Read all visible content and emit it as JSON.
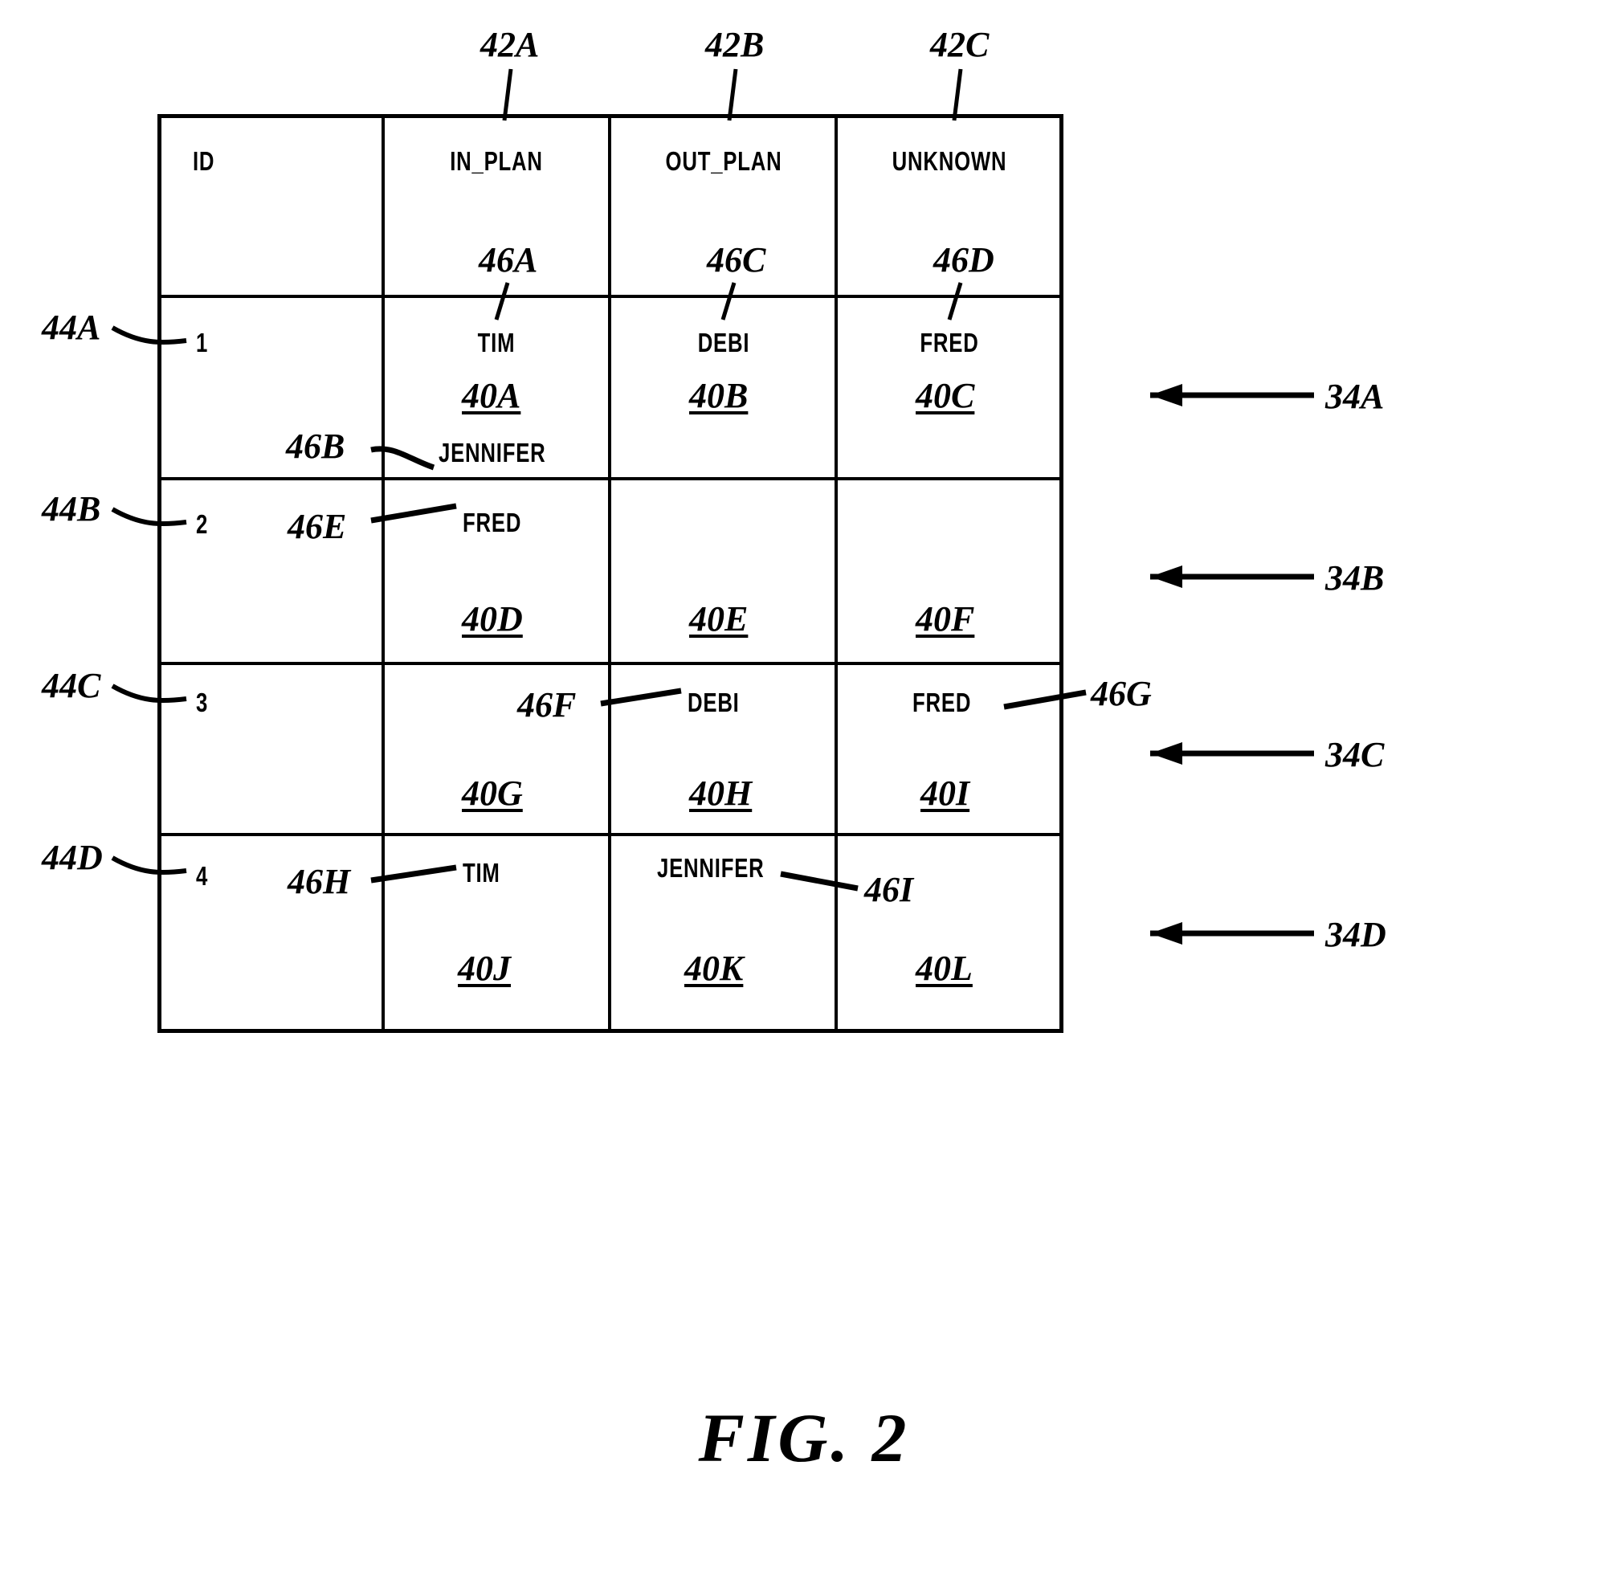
{
  "figure": {
    "caption": "FIG.  2",
    "table_ref_rows": [
      "34A",
      "34B",
      "34C",
      "34D"
    ],
    "row_id_refs": [
      "44A",
      "44B",
      "44C",
      "44D"
    ],
    "column_refs": [
      "42A",
      "42B",
      "42C"
    ]
  },
  "table": {
    "headers": [
      "ID",
      "IN_PLAN",
      "OUT_PLAN",
      "UNKNOWN"
    ],
    "header_refs": [
      "",
      "42A",
      "42B",
      "42C"
    ],
    "rows": [
      {
        "id": "1",
        "id_ref": "44A",
        "row_ref": "34A",
        "cells": [
          {
            "column": "IN_PLAN",
            "names": [
              "TIM",
              "JENNIFER"
            ],
            "name_refs": [
              "46A",
              "46B"
            ],
            "cell_ref": "40A"
          },
          {
            "column": "OUT_PLAN",
            "names": [
              "DEBI"
            ],
            "name_refs": [
              "46C"
            ],
            "cell_ref": "40B"
          },
          {
            "column": "UNKNOWN",
            "names": [
              "FRED"
            ],
            "name_refs": [
              "46D"
            ],
            "cell_ref": "40C"
          }
        ]
      },
      {
        "id": "2",
        "id_ref": "44B",
        "row_ref": "34B",
        "cells": [
          {
            "column": "IN_PLAN",
            "names": [
              "FRED"
            ],
            "name_refs": [
              "46E"
            ],
            "cell_ref": "40D"
          },
          {
            "column": "OUT_PLAN",
            "names": [],
            "name_refs": [],
            "cell_ref": "40E"
          },
          {
            "column": "UNKNOWN",
            "names": [],
            "name_refs": [],
            "cell_ref": "40F"
          }
        ]
      },
      {
        "id": "3",
        "id_ref": "44C",
        "row_ref": "34C",
        "cells": [
          {
            "column": "IN_PLAN",
            "names": [],
            "name_refs": [],
            "cell_ref": "40G"
          },
          {
            "column": "OUT_PLAN",
            "names": [
              "DEBI"
            ],
            "name_refs": [
              "46F"
            ],
            "cell_ref": "40H"
          },
          {
            "column": "UNKNOWN",
            "names": [
              "FRED"
            ],
            "name_refs": [
              "46G"
            ],
            "cell_ref": "40I"
          }
        ]
      },
      {
        "id": "4",
        "id_ref": "44D",
        "row_ref": "34D",
        "cells": [
          {
            "column": "IN_PLAN",
            "names": [
              "TIM"
            ],
            "name_refs": [
              "46H"
            ],
            "cell_ref": "40J"
          },
          {
            "column": "OUT_PLAN",
            "names": [
              "JENNIFER"
            ],
            "name_refs": [
              "46I"
            ],
            "cell_ref": "40K"
          },
          {
            "column": "UNKNOWN",
            "names": [],
            "name_refs": [],
            "cell_ref": "40L"
          }
        ]
      }
    ]
  },
  "labels": {
    "header_id": "ID",
    "header_in_plan": "IN_PLAN",
    "header_out_plan": "OUT_PLAN",
    "header_unknown": "UNKNOWN",
    "ref_42a": "42A",
    "ref_42b": "42B",
    "ref_42c": "42C",
    "ref_44a": "44A",
    "ref_44b": "44B",
    "ref_44c": "44C",
    "ref_44d": "44D",
    "ref_34a": "34A",
    "ref_34b": "34B",
    "ref_34c": "34C",
    "ref_34d": "34D",
    "ref_46a": "46A",
    "ref_46b": "46B",
    "ref_46c": "46C",
    "ref_46d": "46D",
    "ref_46e": "46E",
    "ref_46f": "46F",
    "ref_46g": "46G",
    "ref_46h": "46H",
    "ref_46i": "46I",
    "ref_40a": "40A",
    "ref_40b": "40B",
    "ref_40c": "40C",
    "ref_40d": "40D",
    "ref_40e": "40E",
    "ref_40f": "40F",
    "ref_40g": "40G",
    "ref_40h": "40H",
    "ref_40i": "40I",
    "ref_40j": "40J",
    "ref_40k": "40K",
    "ref_40l": "40L",
    "row_id_1": "1",
    "row_id_2": "2",
    "row_id_3": "3",
    "row_id_4": "4",
    "name_tim_r1": "TIM",
    "name_jennifer_r1": "JENNIFER",
    "name_debi_r1": "DEBI",
    "name_fred_r1": "FRED",
    "name_fred_r2": "FRED",
    "name_debi_r3": "DEBI",
    "name_fred_r3": "FRED",
    "name_tim_r4": "TIM",
    "name_jennifer_r4": "JENNIFER",
    "caption": "FIG.  2"
  },
  "colors": {
    "ink": "#000000",
    "paper": "#ffffff"
  }
}
